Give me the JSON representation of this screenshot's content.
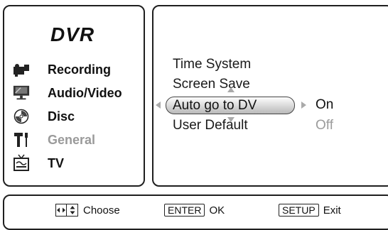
{
  "left_menu": {
    "title": "DVR",
    "items": [
      {
        "label": "Recording",
        "icon": "camcorder-icon",
        "active": true
      },
      {
        "label": "Audio/Video",
        "icon": "monitor-icon",
        "active": true
      },
      {
        "label": "Disc",
        "icon": "disc-icon",
        "active": true
      },
      {
        "label": "General",
        "icon": "tools-icon",
        "active": false
      },
      {
        "label": "TV",
        "icon": "tv-icon",
        "active": true
      }
    ]
  },
  "settings": {
    "options": [
      "Time System",
      "Screen Save",
      "Auto go to DV",
      "User Default"
    ],
    "selected_option": "Auto go to DV",
    "values": {
      "on": "On",
      "off": "Off"
    }
  },
  "footer": {
    "choose_label": "Choose",
    "enter_key": "ENTER",
    "ok_label": "OK",
    "setup_key": "SETUP",
    "exit_label": "Exit"
  },
  "colors": {
    "border": "#1f1f1f",
    "dim_text": "#9a9a9a",
    "highlight_top": "#fdfdfd",
    "highlight_bottom": "#b9b9b9"
  }
}
